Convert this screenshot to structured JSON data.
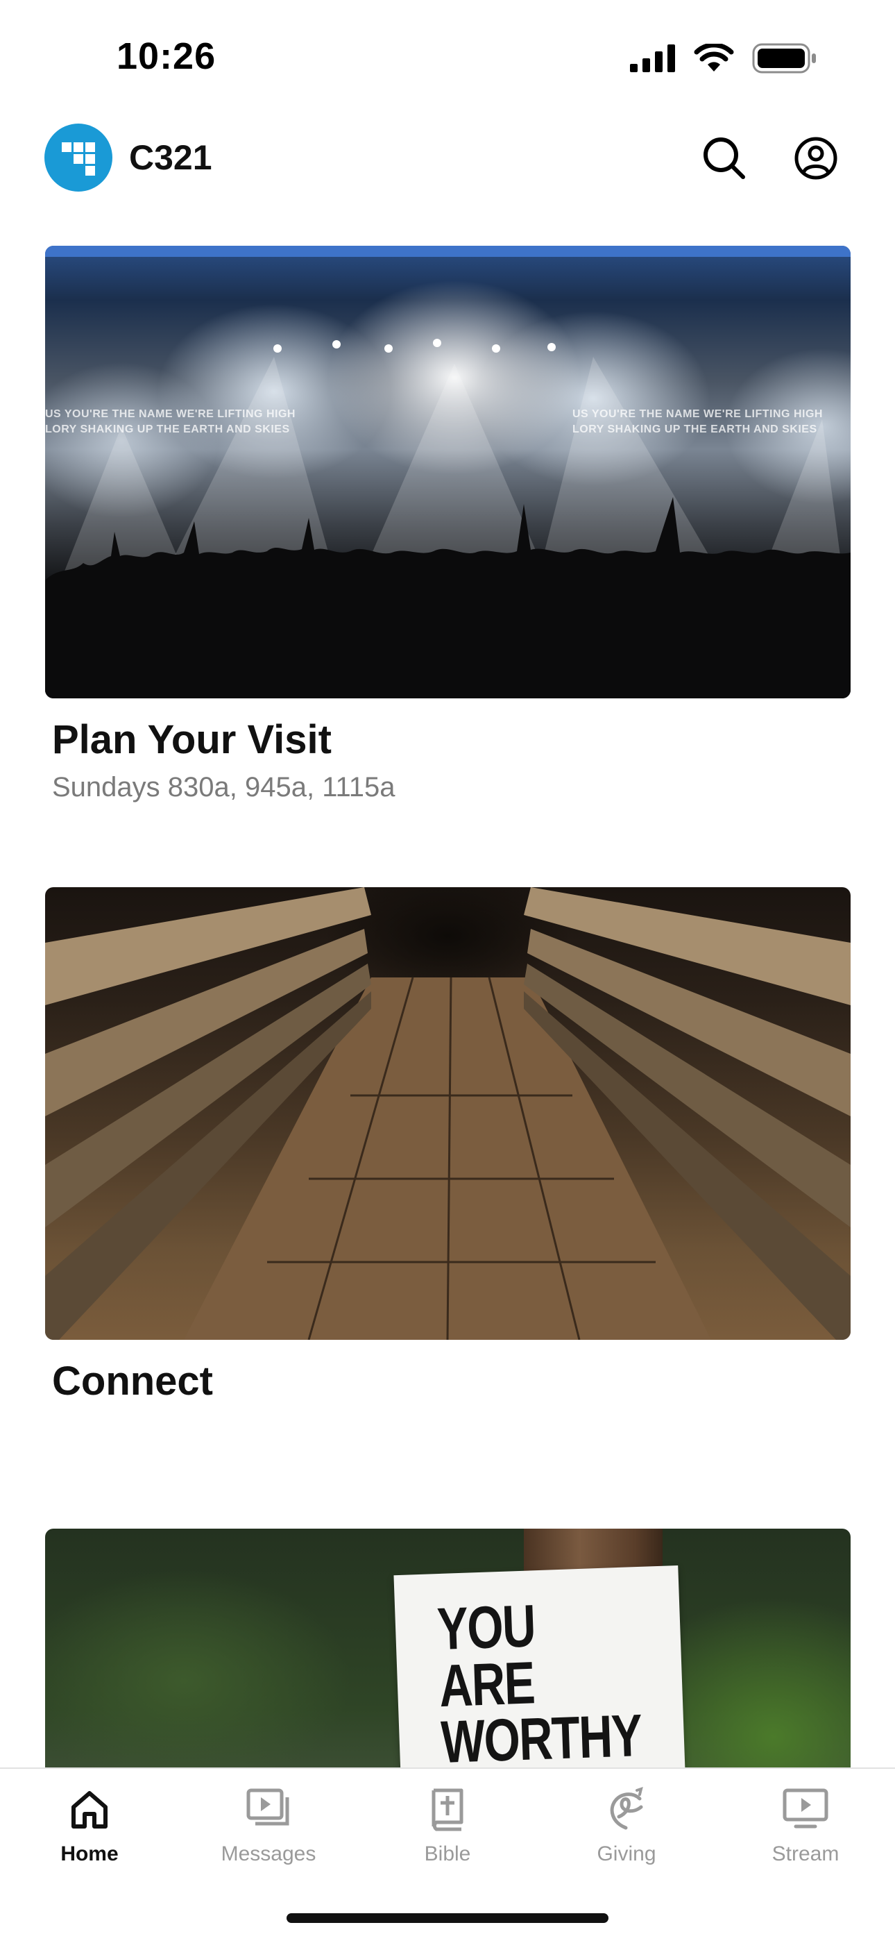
{
  "status_bar": {
    "time": "10:26"
  },
  "header": {
    "app_title": "C321",
    "logo_color": "#1a9ad6"
  },
  "feed": {
    "cards": [
      {
        "title": "Plan Your Visit",
        "subtitle": "Sundays 830a, 945a, 1115a",
        "image": "concert-crowd-worship",
        "screen_lyrics": [
          "US YOU'RE THE NAME WE'RE LIFTING HIGH",
          "LORY SHAKING UP THE EARTH AND SKIES"
        ]
      },
      {
        "title": "Connect",
        "subtitle": "",
        "image": "wooden-bridge"
      },
      {
        "title": "",
        "subtitle": "",
        "image": "sign-on-pole",
        "sign_text": "YOU ARE\nWORTHY\nOF LOVE"
      }
    ]
  },
  "tab_bar": {
    "tabs": [
      {
        "label": "Home",
        "icon": "home-icon",
        "active": true
      },
      {
        "label": "Messages",
        "icon": "video-library-icon",
        "active": false
      },
      {
        "label": "Bible",
        "icon": "bible-icon",
        "active": false
      },
      {
        "label": "Giving",
        "icon": "giving-icon",
        "active": false
      },
      {
        "label": "Stream",
        "icon": "tv-play-icon",
        "active": false
      }
    ],
    "active_color": "#111111",
    "inactive_color": "#9a9a9a"
  }
}
